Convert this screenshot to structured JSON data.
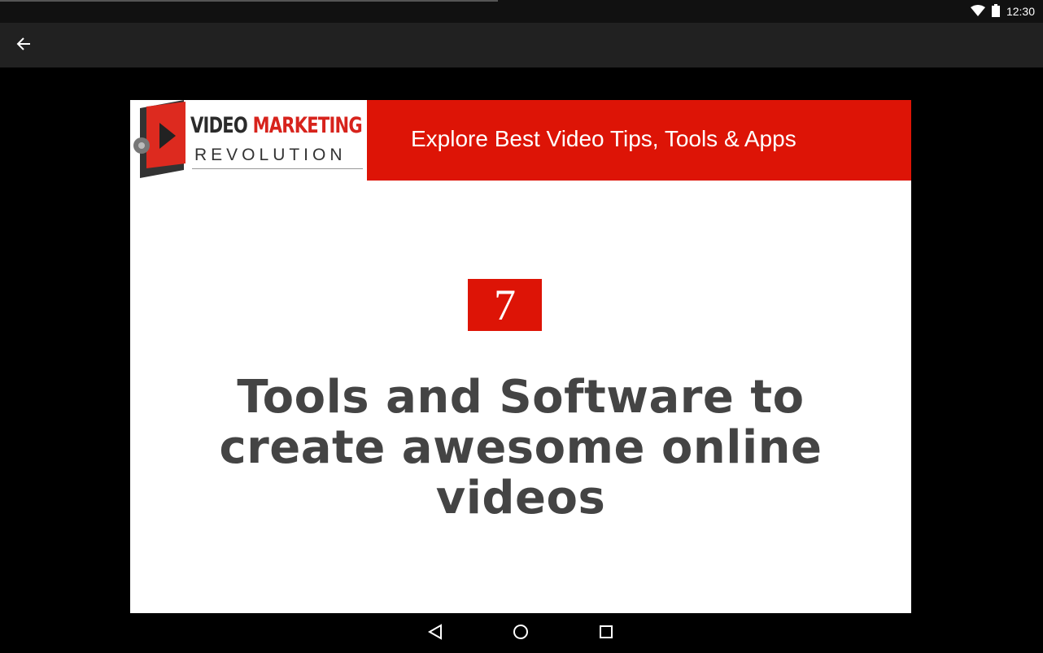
{
  "status_bar": {
    "time": "12:30",
    "icons": [
      "wifi-icon",
      "battery-icon"
    ]
  },
  "toolbar": {
    "back_icon": "arrow-back-icon"
  },
  "video": {
    "logo": {
      "title_part1": "VIDEO",
      "title_part2": "MARKETING",
      "subtitle": "REVOLUTION"
    },
    "tagline": "Explore Best Video Tips, Tools & Apps",
    "number": "7",
    "headline": "Tools and Software to create awesome online videos"
  },
  "nav_bar": {
    "buttons": [
      "back-triangle-icon",
      "home-circle-icon",
      "recents-square-icon"
    ]
  },
  "colors": {
    "brand_red": "#dd1406",
    "toolbar": "#212121",
    "statusbar": "#111111",
    "headline_text": "#444444"
  }
}
